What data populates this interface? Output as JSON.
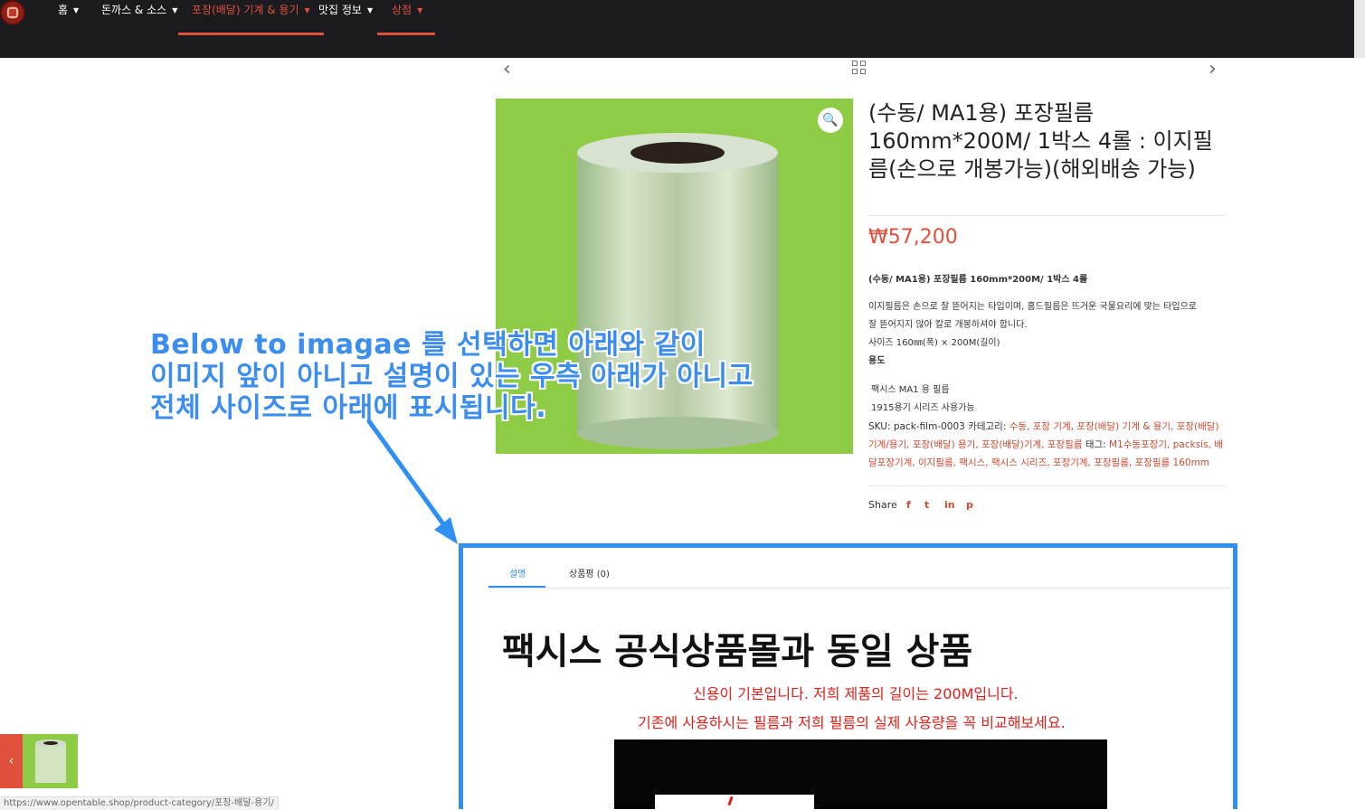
{
  "nav": {
    "items": [
      {
        "label": "홈"
      },
      {
        "label": "돈까스 & 소스"
      },
      {
        "label": "포장(배달) 기계 & 용기"
      },
      {
        "label": "맛집 정보"
      },
      {
        "label": "상점"
      }
    ]
  },
  "product": {
    "title": "(수동/ MA1용) 포장필름 160mm*200M/ 1박스 4롤 : 이지필름(손으로 개봉가능)(해외배송 가능)",
    "price": "₩57,200",
    "short_title": "(수동/ MA1용) 포장필름 160mm*200M/ 1박스 4롤",
    "desc_line1": "이지필름은 손으로 잘 뜯어지는 타입이며, 홈드필름은 뜨거운 국물요리에 맞는 타입으로",
    "desc_line2": "잘 뜯어지지 않아 칼로 개봉하셔야 합니다.",
    "size_line": "사이즈   160㎜(폭)  ×  200M(길이)",
    "usage_label": "용도",
    "usage_1": "팩시스 MA1 용 필름",
    "usage_2": "1915용기 시리즈 사용가능",
    "sku_label": "SKU: pack-film-0003",
    "category_label": "카테고리:",
    "categories": "수동, 포장 기계, 포장(배달) 기계 & 용기, 포장(배달) 기계/용기, 포장(배달) 용기, 포장(배달)기계, 포장필름",
    "tag_label": "태그:",
    "tags": "M1수동포장기, packsis, 배달포장기계, 이지필름, 팩시스, 팩시스 시리즈, 포장기계, 포장필름, 포장필름 160mm",
    "share_label": "Share",
    "social": [
      "f",
      "t",
      "in",
      "p"
    ]
  },
  "annotation": {
    "line1": "Below  to imagae 를 선택하면 아래와 같이",
    "line2": "이미지 앞이 아니고 설명이 있는 우측 아래가 아니고",
    "line3": "전체 사이즈로 아래에 표시됩니다."
  },
  "tabs": [
    {
      "label": "설명"
    },
    {
      "label": "상품평 (0)"
    }
  ],
  "description": {
    "heading": "팩시스 공식상품몰과 동일 상품",
    "line1": "신용이 기본입니다. 저희 제품의 길이는 200M입니다.",
    "line2": "기존에 사용하시는 필름과 저희 필름의 실제 사용량을 꼭 비교해보세요."
  },
  "status_url": "https://www.opentable.shop/product-category/포장-배달-용기/",
  "colors": {
    "accent": "#e0503a",
    "annotation": "#2f8ff2",
    "nav_bg": "#1a1a1f"
  }
}
